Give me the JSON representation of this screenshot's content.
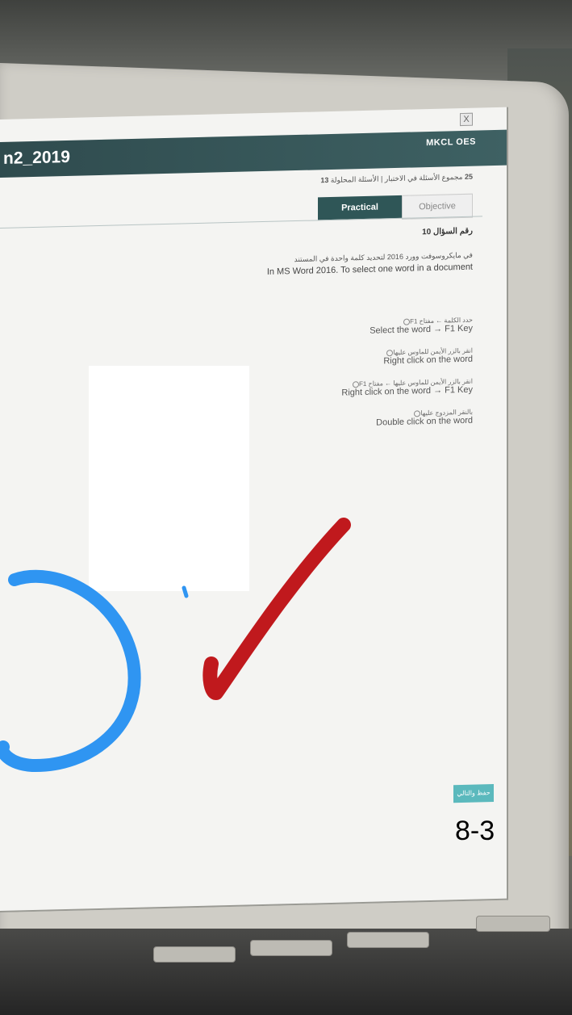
{
  "window": {
    "title": "n2_2019",
    "logo": "MKCL OES",
    "close_glyph": "X"
  },
  "status": {
    "count_total": "25",
    "summary_ar": "مجموع الأسئلة في الاختبار | الأسئلة المحلولة",
    "count_solved": "13"
  },
  "tabs": [
    {
      "label": "Practical",
      "active": true
    },
    {
      "label": "Objective",
      "active": false
    }
  ],
  "question": {
    "number_label_ar": "رقم السؤال",
    "number": "10",
    "text_ar": "في مايكروسوفت وورد 2016 لتحديد كلمة واحدة في المستند",
    "text_en": "In MS Word 2016. To select one word in a document"
  },
  "options": [
    {
      "ar": "حدد الكلمة ← مفتاح F1",
      "en": "Select the word → F1 Key"
    },
    {
      "ar": "انقر بالزر الأيمن للماوس عليها",
      "en": "Right click on the word"
    },
    {
      "ar": "انقر بالزر الأيمن للماوس عليها ← مفتاح F1",
      "en": "Right click on the word → F1 Key"
    },
    {
      "ar": "بالنقر المزدوج عليها",
      "en": "Double click on the word"
    }
  ],
  "submit_label_ar": "حفظ والتالي",
  "overlay_label": "8-3",
  "colors": {
    "titlebar": "#2f4b4e",
    "tab_active": "#2f5657",
    "submit": "#5bb9bd",
    "checkmark": "#c0191d",
    "circle": "#2f95f2"
  }
}
